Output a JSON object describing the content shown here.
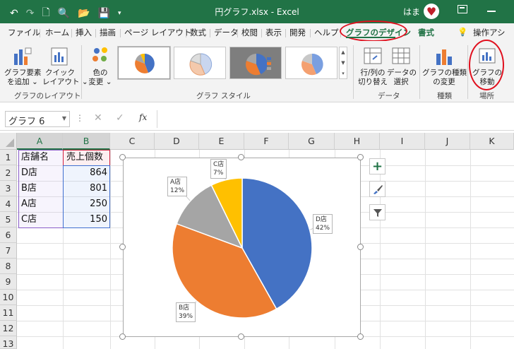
{
  "titlebar": {
    "title": "円グラフ.xlsx  -  Excel",
    "user": "はま"
  },
  "tabs": [
    "ファイル",
    "ホーム",
    "挿入",
    "描画",
    "ページ レイアウト",
    "数式",
    "データ",
    "校閲",
    "表示",
    "開発",
    "ヘルプ",
    "グラフのデザイン",
    "書式",
    "操作アシ"
  ],
  "ribbon": {
    "add_element": [
      "グラフ要素",
      "を追加 ⌄"
    ],
    "quick_layout": [
      "クイック",
      "レイアウト ⌄"
    ],
    "change_colors": [
      "色の",
      "変更 ⌄"
    ],
    "switch_row_col": [
      "行/列の",
      "切り替え"
    ],
    "select_data": [
      "データの",
      "選択"
    ],
    "change_type": [
      "グラフの種類",
      "の変更"
    ],
    "move_chart": [
      "グラフの",
      "移動"
    ],
    "groups": {
      "layout": "グラフのレイアウト",
      "styles": "グラフ スタイル",
      "data": "データ",
      "type": "種類",
      "location": "場所"
    }
  },
  "formula_bar": {
    "name_box": "グラフ 6",
    "fx": "fx"
  },
  "columns": [
    "A",
    "B",
    "C",
    "D",
    "E",
    "F",
    "G",
    "H",
    "I",
    "J",
    "K"
  ],
  "rows": [
    "1",
    "2",
    "3",
    "4",
    "5",
    "6",
    "7",
    "8",
    "9",
    "10",
    "11",
    "12",
    "13"
  ],
  "table": {
    "headers": [
      "店舗名",
      "売上個数"
    ],
    "rows": [
      {
        "store": "D店",
        "sales": "864"
      },
      {
        "store": "B店",
        "sales": "801"
      },
      {
        "store": "A店",
        "sales": "250"
      },
      {
        "store": "C店",
        "sales": "150"
      }
    ]
  },
  "chart_data": {
    "type": "pie",
    "categories": [
      "D店",
      "B店",
      "A店",
      "C店"
    ],
    "values": [
      864,
      801,
      250,
      150
    ],
    "percent_labels": [
      "42%",
      "39%",
      "12%",
      "7%"
    ],
    "colors": [
      "#4472c4",
      "#ed7d31",
      "#a5a5a5",
      "#ffc000"
    ]
  }
}
